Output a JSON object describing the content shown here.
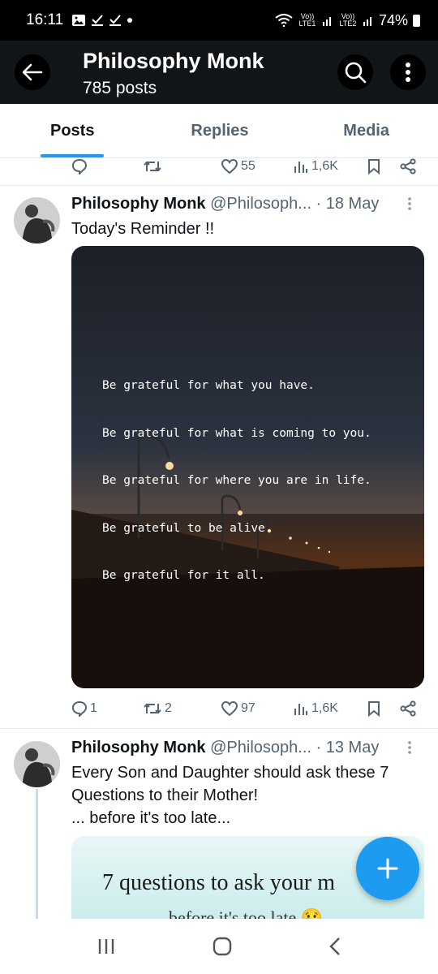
{
  "status_bar": {
    "time": "16:11",
    "indicators": [
      "image-icon",
      "check-download-icon",
      "check-download-icon",
      "dot-icon"
    ],
    "volte1": "Vo)) LTE1",
    "volte2": "Vo)) LTE2",
    "battery": "74%"
  },
  "header": {
    "title": "Philosophy Monk",
    "posts_count": "785 posts"
  },
  "tabs": [
    {
      "label": "Posts",
      "active": true
    },
    {
      "label": "Replies",
      "active": false
    },
    {
      "label": "Media",
      "active": false
    }
  ],
  "prev_tweet_actions": {
    "reposts": "",
    "likes": "55",
    "views": "1,6K"
  },
  "tweets": [
    {
      "name": "Philosophy Monk",
      "handle": "@Philosoph...",
      "date": "· 18 May",
      "text": "Today's Reminder !!",
      "image_quote": [
        "Be grateful for what you have.",
        "Be grateful for what is coming to you.",
        "Be grateful for where you are in life.",
        "Be grateful to be alive.",
        "Be grateful for it all."
      ],
      "actions": {
        "replies": "1",
        "reposts": "2",
        "likes": "97",
        "views": "1,6K"
      }
    },
    {
      "name": "Philosophy Monk",
      "handle": "@Philosoph...",
      "date": "· 13 May",
      "text_lines": [
        "Every Son and Daughter should ask these 7",
        "Questions to their Mother!",
        "... before it's too late..."
      ],
      "image_title": "7 questions to ask your m",
      "image_subtitle": "before it's too late 😢"
    }
  ],
  "colors": {
    "accent": "#1d9bf0",
    "header_bg": "#111518",
    "muted": "#536471"
  }
}
